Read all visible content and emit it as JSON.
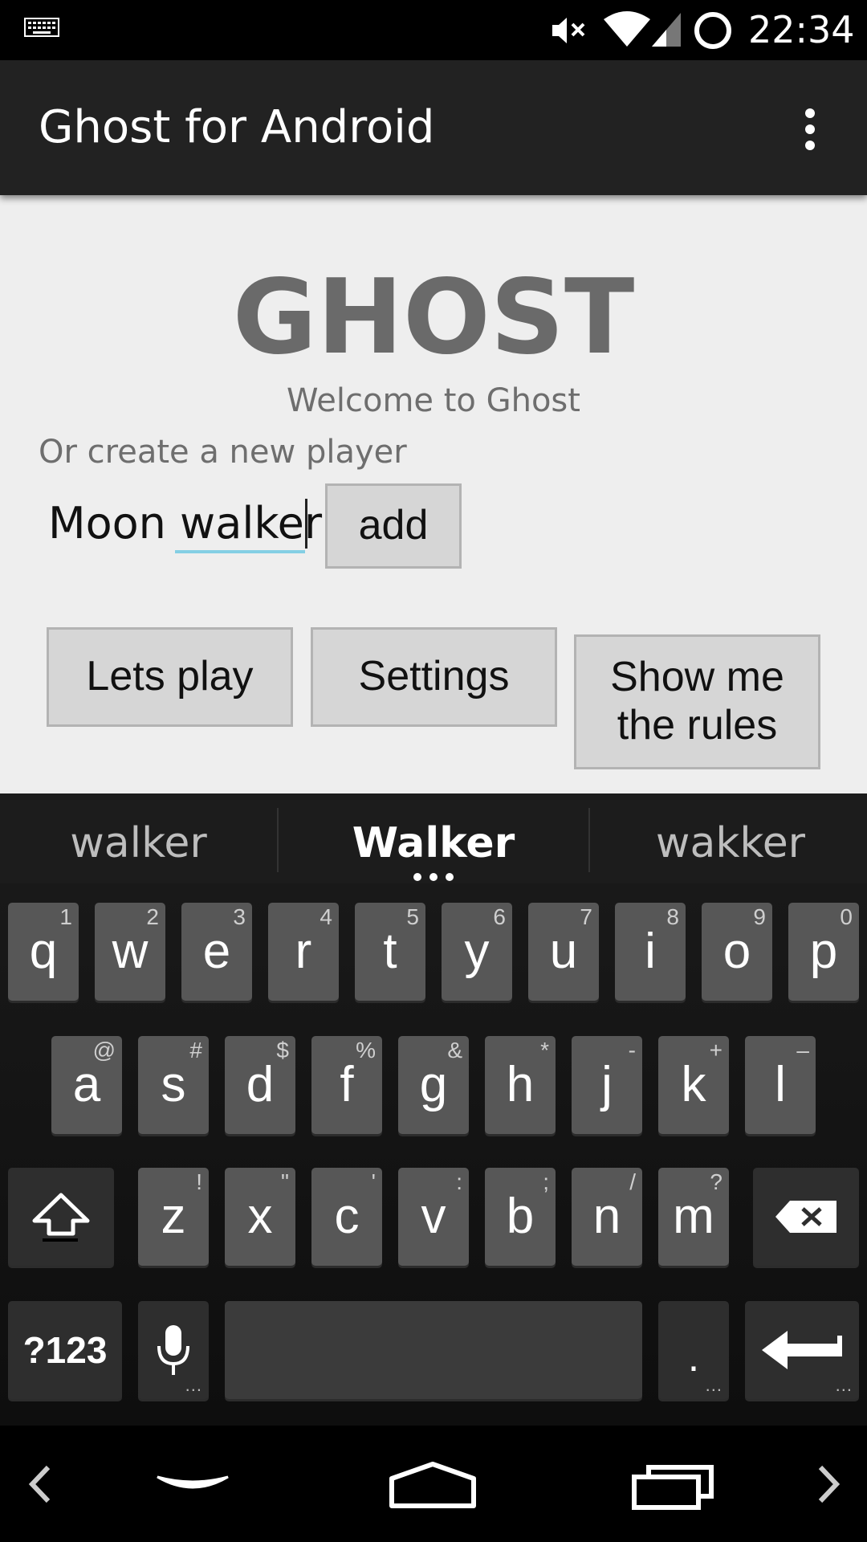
{
  "status_bar": {
    "time": "22:34",
    "icons": [
      "keyboard-icon",
      "mute-icon",
      "wifi-icon",
      "signal-icon",
      "sync-icon"
    ]
  },
  "action_bar": {
    "title": "Ghost for Android",
    "overflow_icon": "more-vert-icon"
  },
  "main": {
    "game_title": "GHOST",
    "welcome_text": "Welcome to Ghost",
    "create_player_label": "Or create a new player",
    "player_name_value": "Moon walker",
    "add_button": "add",
    "lets_play_button": "Lets play",
    "settings_button": "Settings",
    "rules_button": "Show me the rules"
  },
  "keyboard": {
    "suggestions": [
      "walker",
      "Walker",
      "wakker"
    ],
    "row1": [
      {
        "k": "q",
        "h": "1"
      },
      {
        "k": "w",
        "h": "2"
      },
      {
        "k": "e",
        "h": "3"
      },
      {
        "k": "r",
        "h": "4"
      },
      {
        "k": "t",
        "h": "5"
      },
      {
        "k": "y",
        "h": "6"
      },
      {
        "k": "u",
        "h": "7"
      },
      {
        "k": "i",
        "h": "8"
      },
      {
        "k": "o",
        "h": "9"
      },
      {
        "k": "p",
        "h": "0"
      }
    ],
    "row2": [
      {
        "k": "a",
        "h": "@"
      },
      {
        "k": "s",
        "h": "#"
      },
      {
        "k": "d",
        "h": "$"
      },
      {
        "k": "f",
        "h": "%"
      },
      {
        "k": "g",
        "h": "&"
      },
      {
        "k": "h",
        "h": "*"
      },
      {
        "k": "j",
        "h": "-"
      },
      {
        "k": "k",
        "h": "+"
      },
      {
        "k": "l",
        "h": "–"
      }
    ],
    "row3": [
      {
        "k": "z",
        "h": "!"
      },
      {
        "k": "x",
        "h": "\""
      },
      {
        "k": "c",
        "h": "'"
      },
      {
        "k": "v",
        "h": ":"
      },
      {
        "k": "b",
        "h": ";"
      },
      {
        "k": "n",
        "h": "/"
      },
      {
        "k": "m",
        "h": "?"
      }
    ],
    "symbols_key": "?123",
    "period_key": ".",
    "more_dots": "...",
    "icons": [
      "shift-icon",
      "backspace-icon",
      "mic-icon",
      "enter-icon"
    ]
  },
  "nav_bar": {
    "icons": [
      "left-arrow-icon",
      "hide-keyboard-icon",
      "home-icon",
      "recents-icon",
      "right-arrow-icon"
    ]
  },
  "colors": {
    "status_bar": "#000000",
    "action_bar": "#222222",
    "content_bg": "#eeeeee",
    "title_gray": "#6a6a6a",
    "button_bg": "#d6d6d6",
    "input_underline": "#84cfe4",
    "key_bg": "#575757",
    "keyboard_bg": "#1b1b1b"
  }
}
